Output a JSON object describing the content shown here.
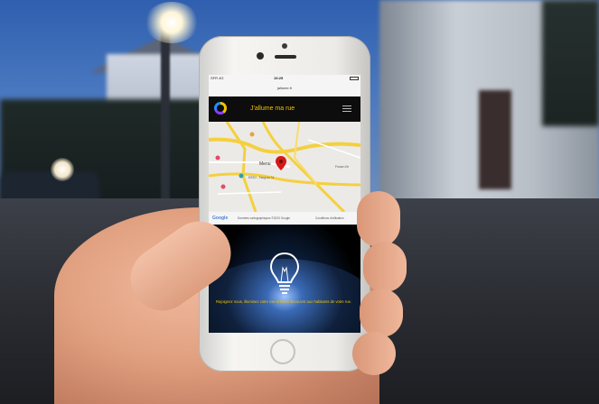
{
  "photo": {
    "subject": "hand holding smartphone on street at dusk"
  },
  "phone": {
    "status": {
      "carrier": "SFR 4G",
      "time": "19:25"
    },
    "url": "jallume.fr",
    "app": {
      "title": "J'allume ma rue"
    },
    "map": {
      "labels": {
        "place_center": "Menu",
        "place_right": "Fosse d'e",
        "place_bottom": "ESSO - Faugi du Ta"
      },
      "footer": {
        "google": "Google",
        "data": "Données cartographiques ©2023 Google",
        "conditions": "Conditions d'utilisation"
      }
    },
    "hero": {
      "text": "Rejoignez nous, illuminez votre rue et faites découvrir aux habitants de votre rue."
    }
  },
  "colors": {
    "accent": "#f2c300",
    "pin": "#d41919"
  }
}
